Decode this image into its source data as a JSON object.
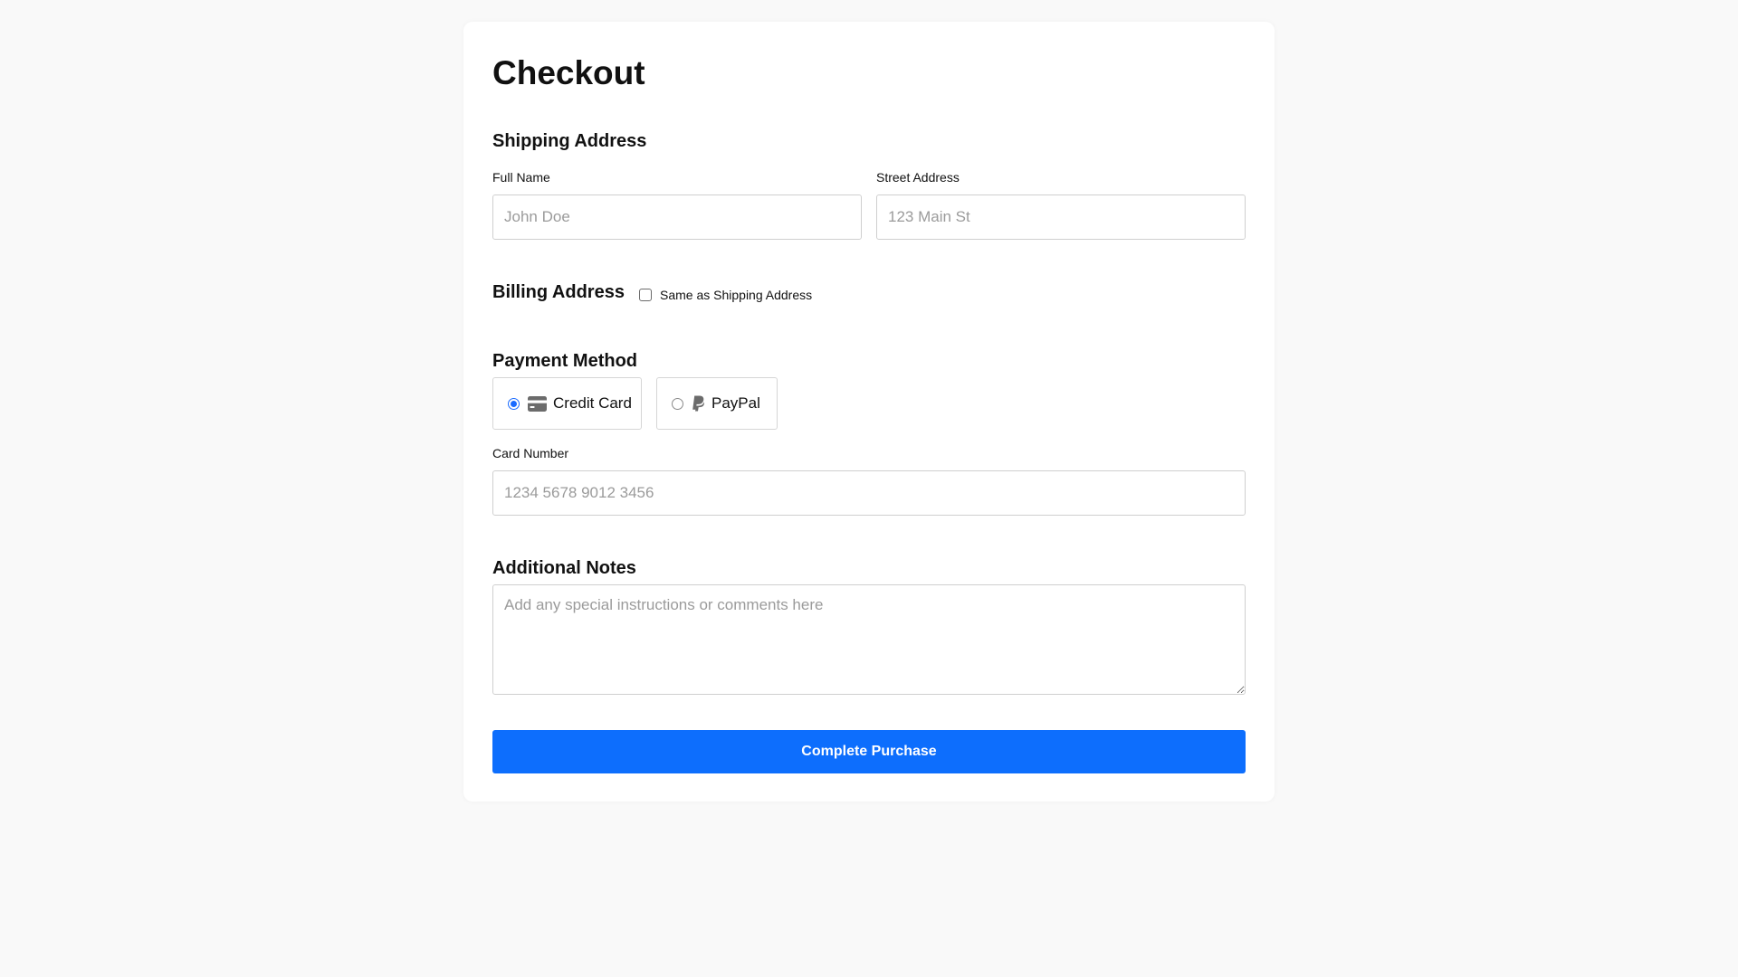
{
  "page": {
    "title": "Checkout"
  },
  "shipping": {
    "title": "Shipping Address",
    "full_name": {
      "label": "Full Name",
      "placeholder": "John Doe",
      "value": ""
    },
    "street": {
      "label": "Street Address",
      "placeholder": "123 Main St",
      "value": ""
    }
  },
  "billing": {
    "title": "Billing Address",
    "same_as_shipping": {
      "label": "Same as Shipping Address",
      "checked": false
    }
  },
  "payment": {
    "title": "Payment Method",
    "options": [
      {
        "label": "Credit Card",
        "icon": "credit-card-icon",
        "selected": true
      },
      {
        "label": "PayPal",
        "icon": "paypal-icon",
        "selected": false
      }
    ],
    "card_number": {
      "label": "Card Number",
      "placeholder": "1234 5678 9012 3456",
      "value": ""
    }
  },
  "notes": {
    "title": "Additional Notes",
    "placeholder": "Add any special instructions or comments here"
  },
  "submit": {
    "label": "Complete Purchase"
  },
  "colors": {
    "accent": "#0d6efd",
    "background": "#f9f9f9",
    "card": "#ffffff",
    "border": "#cfcfcf",
    "icon_gray": "#6b6b6b"
  }
}
